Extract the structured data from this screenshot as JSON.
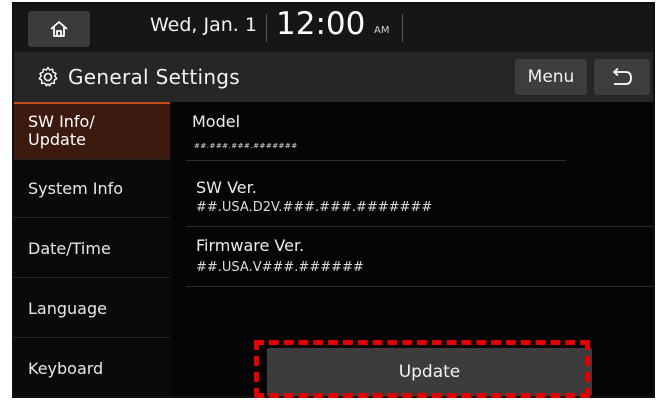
{
  "status_bar": {
    "date": "Wed, Jan. 1",
    "time": "12:00",
    "ampm": "AM",
    "home_icon": "home-icon"
  },
  "title_bar": {
    "title": "General Settings",
    "title_icon": "gear-icon",
    "menu_label": "Menu",
    "back_icon": "back-icon"
  },
  "sidebar": {
    "items": [
      {
        "label": "SW Info/\nUpdate",
        "active": true
      },
      {
        "label": "System Info",
        "active": false
      },
      {
        "label": "Date/Time",
        "active": false
      },
      {
        "label": "Language",
        "active": false
      },
      {
        "label": "Keyboard",
        "active": false
      }
    ]
  },
  "content": {
    "model_label": "Model",
    "model_value": "##.###.###.#######",
    "sw_ver_label": "SW Ver.",
    "sw_ver_value": "##.USA.D2V.###.###.#######",
    "firmware_label": "Firmware Ver.",
    "firmware_value": "##.USA.V###.######",
    "update_label": "Update"
  },
  "colors": {
    "accent": "#c24a1c",
    "active_bg": "#3d1a10",
    "highlight": "#e00000"
  }
}
